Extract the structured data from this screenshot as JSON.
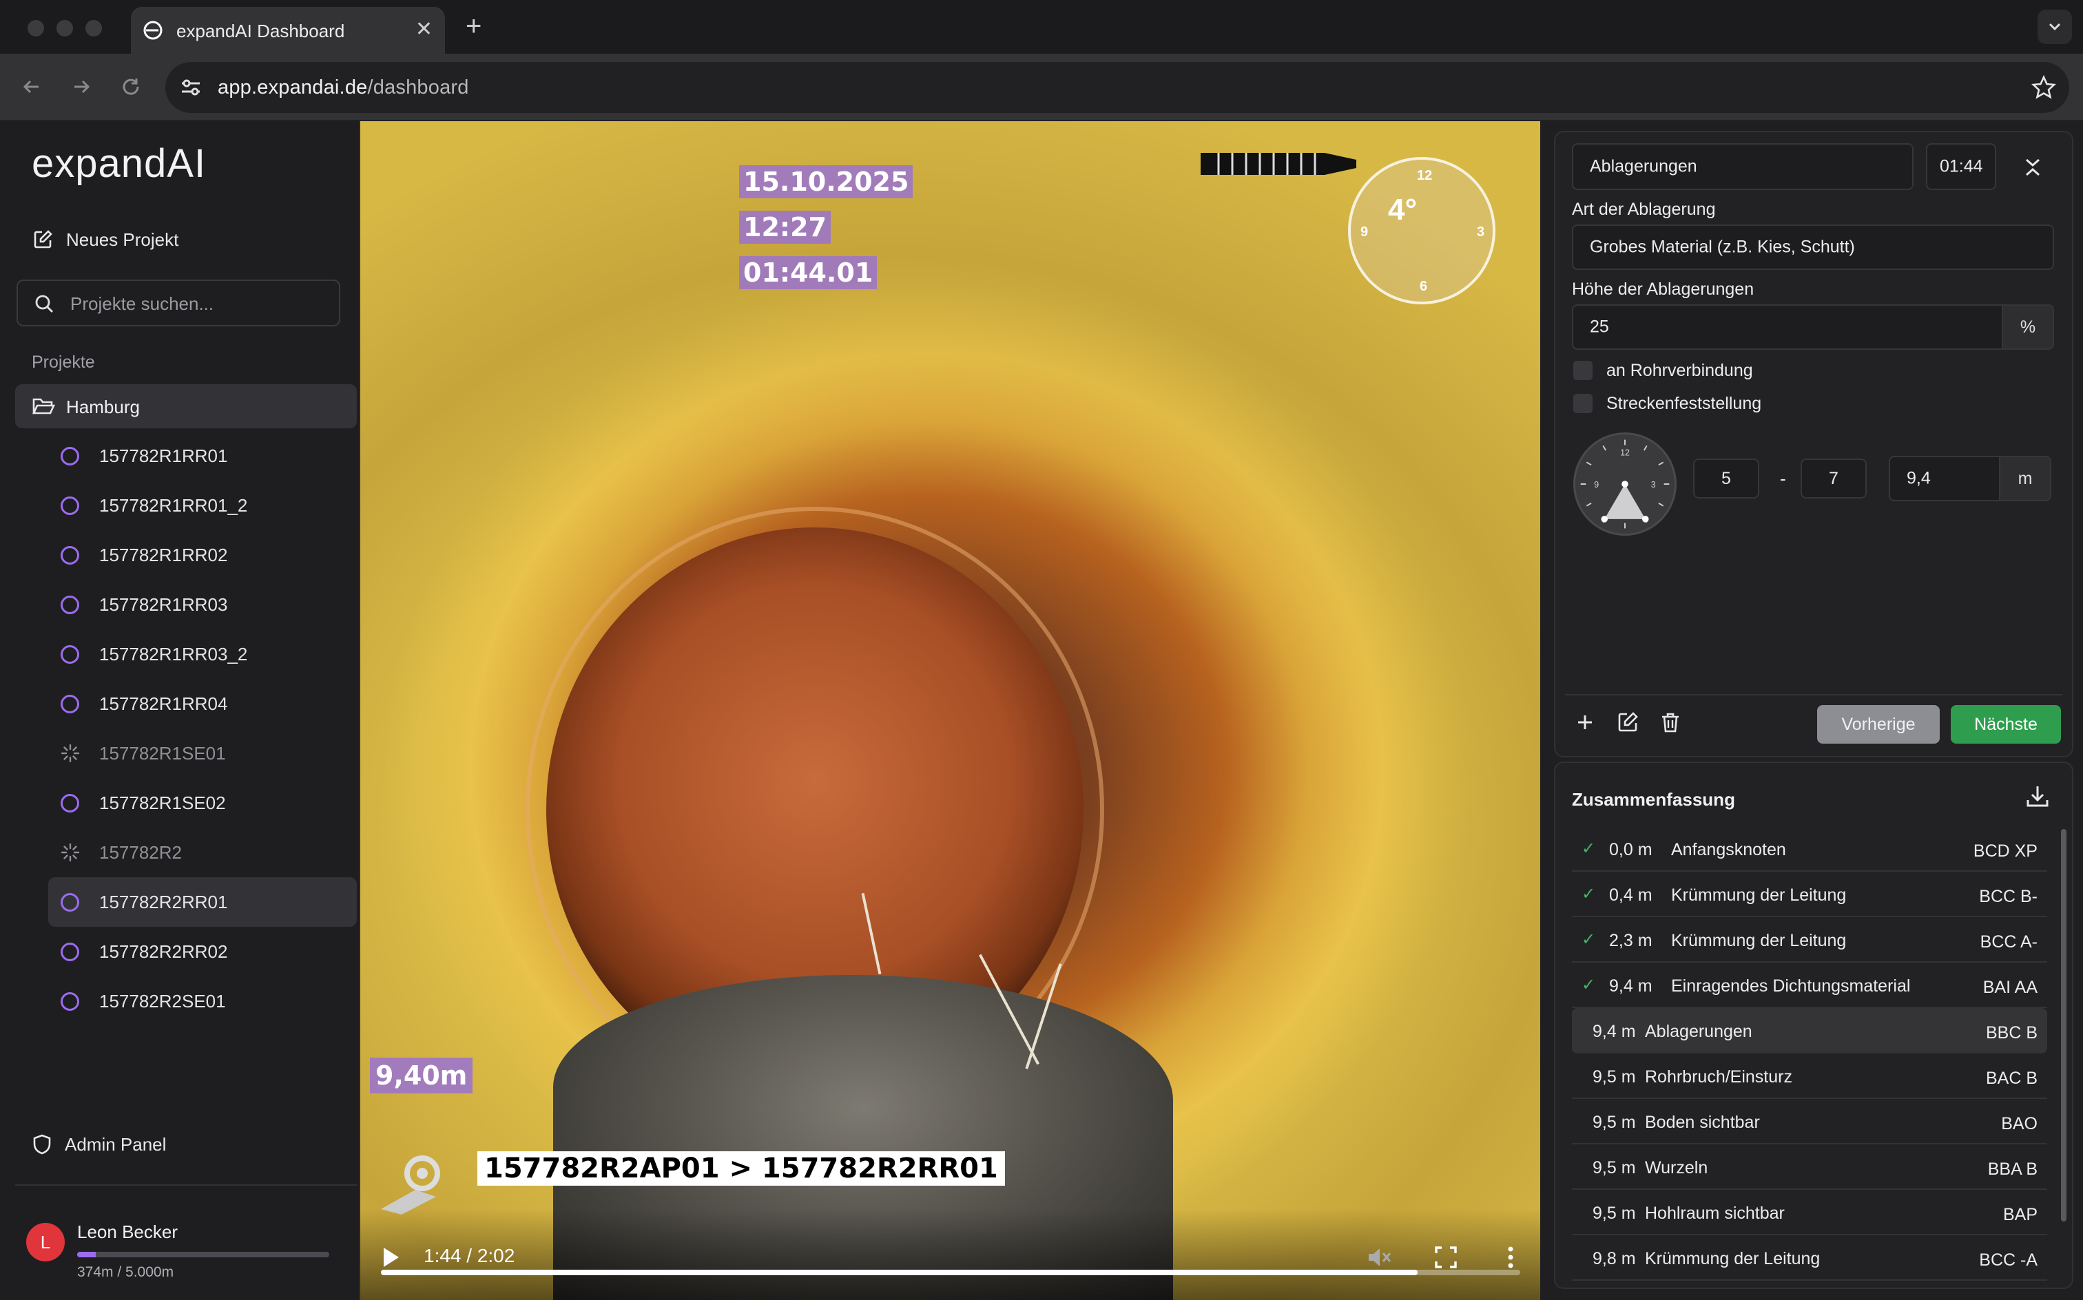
{
  "browser": {
    "tab_title": "expandAI Dashboard",
    "url_host": "app.expandai.de",
    "url_path": "/dashboard"
  },
  "sidebar": {
    "logo": "expandAI",
    "new_project": "Neues Projekt",
    "search_placeholder": "Projekte suchen...",
    "section_label": "Projekte",
    "folder": "Hamburg",
    "projects": [
      {
        "label": "157782R1RR01",
        "state": "ring"
      },
      {
        "label": "157782R1RR01_2",
        "state": "ring"
      },
      {
        "label": "157782R1RR02",
        "state": "ring"
      },
      {
        "label": "157782R1RR03",
        "state": "ring"
      },
      {
        "label": "157782R1RR03_2",
        "state": "ring"
      },
      {
        "label": "157782R1RR04",
        "state": "ring"
      },
      {
        "label": "157782R1SE01",
        "state": "loading"
      },
      {
        "label": "157782R1SE02",
        "state": "ring"
      },
      {
        "label": "157782R2",
        "state": "loading"
      },
      {
        "label": "157782R2RR01",
        "state": "active"
      },
      {
        "label": "157782R2RR02",
        "state": "ring"
      },
      {
        "label": "157782R2SE01",
        "state": "ring"
      }
    ],
    "admin_panel": "Admin Panel",
    "user": {
      "initial": "L",
      "name": "Leon Becker",
      "quota": "374m / 5.000m",
      "quota_fraction": 0.075
    }
  },
  "video": {
    "date": "15.10.2025",
    "time": "12:27",
    "timecode": "01:44.01",
    "distance": "9,40m",
    "camera_label": "157782R2AP01 > 157782R2RR01",
    "compass_angle": "4°",
    "compass_ticks": {
      "top": "12",
      "right": "3",
      "bottom": "6",
      "left": "9"
    },
    "player_time": "1:44 / 2:02",
    "progress_fraction": 0.91
  },
  "form": {
    "type_value": "Ablagerungen",
    "timestamp": "01:44",
    "art_label": "Art der Ablagerung",
    "art_value": "Grobes Material (z.B. Kies, Schutt)",
    "hoehe_label": "Höhe der Ablagerungen",
    "hoehe_value": "25",
    "hoehe_unit": "%",
    "chk_rohrverbindung": "an Rohrverbindung",
    "chk_strecken": "Streckenfeststellung",
    "clock_from": "5",
    "clock_sep": "-",
    "clock_to": "7",
    "distance_value": "9,4",
    "distance_unit": "m",
    "btn_prev": "Vorherige",
    "btn_next": "Nächste"
  },
  "summary": {
    "title": "Zusammenfassung",
    "rows": [
      {
        "checked": true,
        "dist": "0,0 m",
        "desc": "Anfangsknoten",
        "code": "BCD XP"
      },
      {
        "checked": true,
        "dist": "0,4 m",
        "desc": "Krümmung der Leitung",
        "code": "BCC B-"
      },
      {
        "checked": true,
        "dist": "2,3 m",
        "desc": "Krümmung der Leitung",
        "code": "BCC A-"
      },
      {
        "checked": true,
        "dist": "9,4 m",
        "desc": "Einragendes Dichtungsmaterial",
        "code": "BAI AA"
      },
      {
        "checked": false,
        "active": true,
        "dist": "9,4 m",
        "desc": "Ablagerungen",
        "code": "BBC B"
      },
      {
        "checked": false,
        "dist": "9,5 m",
        "desc": "Rohrbruch/Einsturz",
        "code": "BAC B"
      },
      {
        "checked": false,
        "dist": "9,5 m",
        "desc": "Boden sichtbar",
        "code": "BAO"
      },
      {
        "checked": false,
        "dist": "9,5 m",
        "desc": "Wurzeln",
        "code": "BBA B"
      },
      {
        "checked": false,
        "dist": "9,5 m",
        "desc": "Hohlraum sichtbar",
        "code": "BAP"
      },
      {
        "checked": false,
        "dist": "9,8 m",
        "desc": "Krümmung der Leitung",
        "code": "BCC -A"
      }
    ]
  },
  "colors": {
    "accent": "#9b6cf0",
    "next_button": "#2e9e4e",
    "prev_button": "#8c8e94",
    "check": "#43b265",
    "avatar": "#e0353b"
  }
}
